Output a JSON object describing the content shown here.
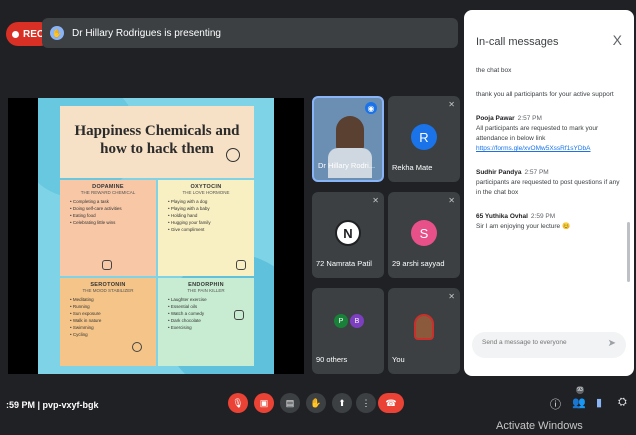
{
  "recording": {
    "label": "REC"
  },
  "presenting": {
    "text": "Dr Hillary Rodrigues is presenting"
  },
  "slide": {
    "title_line1": "Happiness Chemicals and",
    "title_line2": "how to hack them",
    "quadrants": [
      {
        "title": "DOPAMINE",
        "subtitle": "THE REWARD CHEMICAL",
        "items": [
          "Completing a task",
          "Doing self-care activities",
          "Eating food",
          "Celebrating little wins"
        ]
      },
      {
        "title": "OXYTOCIN",
        "subtitle": "THE LOVE HORMONE",
        "items": [
          "Playing with a dog",
          "Playing with a baby",
          "Holding hand",
          "Hugging your family",
          "Give compliment"
        ]
      },
      {
        "title": "SEROTONIN",
        "subtitle": "THE MOOD STABILIZER",
        "items": [
          "Meditating",
          "Running",
          "Sun exposure",
          "Walk in nature",
          "Swimming",
          "Cycling"
        ]
      },
      {
        "title": "ENDORPHIN",
        "subtitle": "THE PAIN KILLER",
        "items": [
          "Laughter exercise",
          "Essential oils",
          "Watch a comedy",
          "Dark chocolate",
          "Exercising"
        ]
      }
    ]
  },
  "participants": [
    {
      "name": "Dr Hillary Rodri...",
      "initial": "",
      "color": "#6b8fb3"
    },
    {
      "name": "Rekha Mate",
      "initial": "R",
      "color": "#1a73e8"
    },
    {
      "name": "72 Namrata Patil",
      "initial": "N",
      "color": "#ffffff"
    },
    {
      "name": "29 arshi sayyad",
      "initial": "S",
      "color": "#e8508a"
    },
    {
      "name": "90 others",
      "initial": "P B",
      "color": "#188038"
    },
    {
      "name": "You",
      "initial": "",
      "color": "#8b5a3c"
    }
  ],
  "chat": {
    "title": "In-call messages",
    "close": "X",
    "messages": [
      {
        "sender": "",
        "time": "",
        "text": "the chat box"
      },
      {
        "sender": "",
        "time": "",
        "text": "thank you all participants for your active support"
      },
      {
        "sender": "Pooja Pawar",
        "time": "2:57 PM",
        "text": "All participants are requested to mark your attendance in below link",
        "link": "https://forms.gle/xvOMw5XssRf1sYDbA"
      },
      {
        "sender": "Sudhir Pandya",
        "time": "2:57 PM",
        "text": "participants are requested to post questions if any in the chat box"
      },
      {
        "sender": "65 Yuthika Ovhal",
        "time": "2:59 PM",
        "text": "Sir I am enjoying your lecture 😊"
      }
    ],
    "input_placeholder": "Send a message to everyone"
  },
  "footer": {
    "time_code": ":59 PM | pvp-vxyf-bgk",
    "activate": "Activate Windows",
    "badge": "93"
  }
}
